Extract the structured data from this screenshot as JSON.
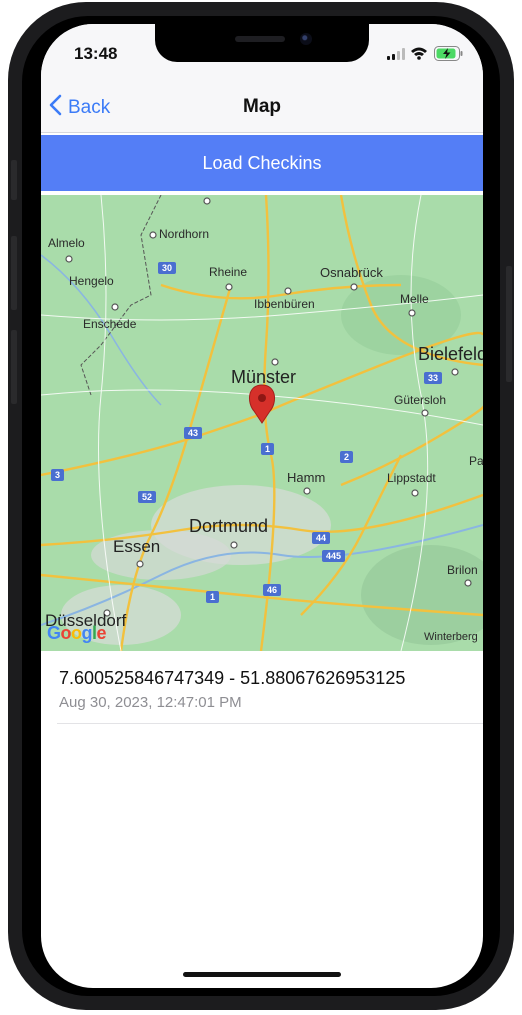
{
  "status": {
    "time": "13:48"
  },
  "nav": {
    "back_label": "Back",
    "title": "Map"
  },
  "toolbar": {
    "load_label": "Load Checkins"
  },
  "map": {
    "cities": [
      "Almelo",
      "Nordhorn",
      "Hengelo",
      "Rheine",
      "Osnabrück",
      "Melle",
      "Enschede",
      "Ibbenbüren",
      "Bielefeld",
      "Münster",
      "Gütersloh",
      "Hamm",
      "Lippstadt",
      "Dortmund",
      "Essen",
      "Brilon",
      "Düsseldorf",
      "Winterberg",
      "Pa"
    ],
    "roads": [
      "30",
      "43",
      "1",
      "2",
      "33",
      "3",
      "52",
      "44",
      "445",
      "1",
      "46"
    ],
    "attribution": "Google"
  },
  "checkins": [
    {
      "coords": "7.600525846747349 - 51.88067626953125",
      "time": "Aug 30, 2023, 12:47:01 PM"
    }
  ],
  "colors": {
    "accent": "#547ef6",
    "link": "#3b7bf7",
    "map_land": "#a9dcaa",
    "pin": "#d6302a"
  },
  "icons": [
    "chevron-left-icon",
    "signal-icon",
    "wifi-icon",
    "battery-icon",
    "map-pin-icon"
  ]
}
